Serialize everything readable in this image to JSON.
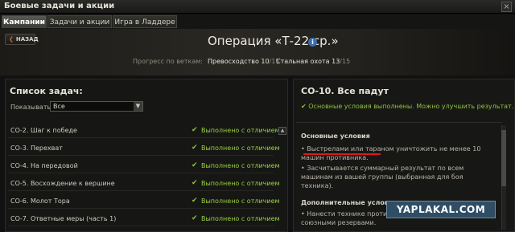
{
  "window": {
    "title": "Боевые задачи и акции",
    "close_glyph": "×"
  },
  "tabs": [
    {
      "label": "Кампании",
      "active": true
    },
    {
      "label": "Задачи и акции",
      "active": false
    },
    {
      "label": "Игра в Ладдере",
      "active": false
    }
  ],
  "header": {
    "back_label": "НАЗАД",
    "back_icon": "chevron-left-icon",
    "operation_title": "Операция «Т-22 ср.»",
    "info_icon": "info-icon",
    "progress_label": "Прогресс по веткам:",
    "branches": [
      {
        "name": "Превосходство",
        "done": "10",
        "total": "/15"
      },
      {
        "name": "Стальная охота",
        "done": "13",
        "total": "/15"
      }
    ]
  },
  "task_list": {
    "title": "Список задач:",
    "filter_label": "Показывать:",
    "filter_value": "Все",
    "items": [
      {
        "name": "СО-2. Шаг к победе",
        "status": "Выполнено с отличием"
      },
      {
        "name": "СО-3. Перехват",
        "status": "Выполнено с отличием"
      },
      {
        "name": "СО-4. На передовой",
        "status": "Выполнено с отличием"
      },
      {
        "name": "СО-5. Восхождение к вершине",
        "status": "Выполнено с отличием"
      },
      {
        "name": "СО-6. Молот Тора",
        "status": "Выполнено с отличием"
      },
      {
        "name": "СО-7. Ответные меры (часть 1)",
        "status": "Выполнено с отличием"
      }
    ]
  },
  "task_detail": {
    "title": "СО-10. Все падут",
    "hint": "Основные условия выполнены. Можно улучшить результат.",
    "main_conditions_title": "Основные условия",
    "main_conditions": [
      "• Выстрелами или тараном уничтожить не менее 10 машин противника.",
      "• Засчитывается суммарный результат по всем машинам из вашей группы (выбранная для боя техника)."
    ],
    "extra_conditions_title": "Дополнительные условия",
    "extra_conditions": [
      "• Нанести технике противника урона 5 вашими союзными резервами."
    ]
  },
  "watermark": "YAPLAKAL.COM",
  "colors": {
    "accent_green": "#9bd13f",
    "highlight_red": "#e01818",
    "back_arrow": "#e0642a"
  }
}
